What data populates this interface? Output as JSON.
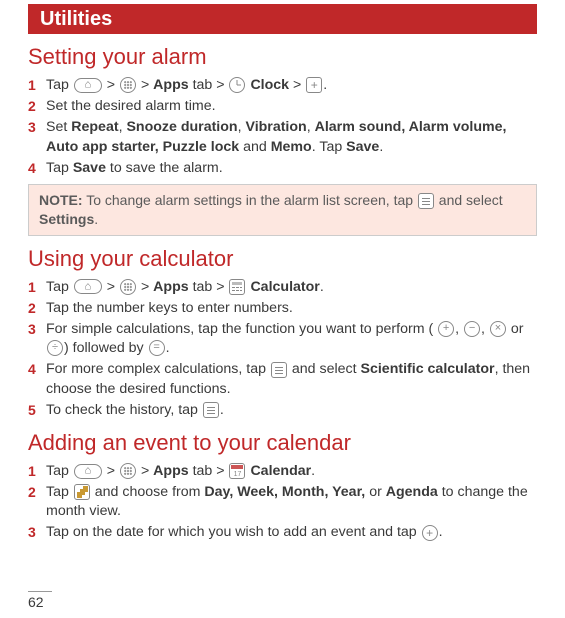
{
  "header": {
    "title": "Utilities"
  },
  "page_number": "62",
  "sections": {
    "alarm": {
      "title": "Setting your alarm",
      "steps": {
        "s1": {
          "pre": "Tap ",
          "apps": "Apps",
          "tab": " tab > ",
          "clock": "Clock",
          "end": " > "
        },
        "s2": "Set the desired alarm time.",
        "s3": {
          "a": "Set ",
          "b": "Repeat",
          "c": ", ",
          "d": "Snooze duration",
          "e": ", ",
          "f": "Vibration",
          "g": ", ",
          "h": "Alarm sound, Alarm volume, Auto app starter, Puzzle lock",
          "i": " and ",
          "j": "Memo",
          "k": ". Tap ",
          "l": "Save",
          "m": "."
        },
        "s4": {
          "a": "Tap ",
          "b": "Save",
          "c": " to save the alarm."
        }
      },
      "note": {
        "label": "NOTE:",
        "text1": " To change alarm settings in the alarm list screen, tap ",
        "text2": " and select ",
        "settings": "Settings",
        "end": "."
      }
    },
    "calc": {
      "title": "Using your calculator",
      "steps": {
        "s1": {
          "pre": "Tap ",
          "apps": "Apps",
          "tab": " tab > ",
          "calc": "Calculator",
          "end": "."
        },
        "s2": "Tap the number keys to enter numbers.",
        "s3": {
          "a": "For simple calculations, tap the function you want to perform ( ",
          "b": ", ",
          "c": ", ",
          "d": " or ",
          "e": ") followed by ",
          "f": "."
        },
        "s4": {
          "a": "For more complex calculations, tap ",
          "b": " and select ",
          "c": "Scientific calculator",
          "d": ", then choose the desired functions."
        },
        "s5": {
          "a": "To check the history, tap ",
          "b": "."
        }
      }
    },
    "cal": {
      "title": "Adding an event to your calendar",
      "steps": {
        "s1": {
          "pre": "Tap ",
          "apps": "Apps",
          "tab": " tab > ",
          "cal": "Calendar",
          "end": "."
        },
        "s2": {
          "a": "Tap ",
          "b": " and choose from ",
          "c": "Day, Week, Month, Year,",
          "d": " or ",
          "e": "Agenda",
          "f": " to change the month view."
        },
        "s3": {
          "a": "Tap on the date for which you wish to add an event and tap ",
          "b": "."
        }
      }
    }
  }
}
